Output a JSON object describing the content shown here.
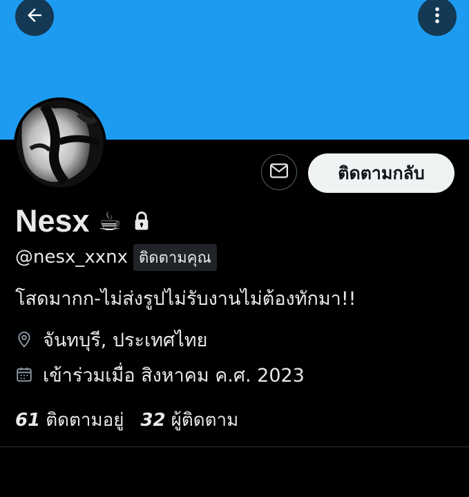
{
  "colors": {
    "banner": "#1d9bf0",
    "background": "#000000",
    "text": "#e7e9ea",
    "button_bg": "#eff3f4",
    "button_text": "#0f1419"
  },
  "header": {
    "back_icon": "arrow-left-icon",
    "more_icon": "more-vertical-icon"
  },
  "profile": {
    "name": "Nesx",
    "name_emoji": "☕",
    "protected_icon": "lock-icon",
    "handle": "@nesx_xxnx",
    "follows_you_label": "ติดตามคุณ",
    "bio": "โสดมากก-ไม่ส่งรูปไม่รับงานไม่ต้องทักมา!!",
    "location": "จันทบุรี, ประเทศไทย",
    "joined": "เข้าร่วมเมื่อ สิงหาคม ค.ศ. 2023"
  },
  "actions": {
    "message_icon": "envelope-icon",
    "follow_back_label": "ติดตามกลับ"
  },
  "stats": {
    "following_count": "61",
    "following_label": "ติดตามอยู่",
    "followers_count": "32",
    "followers_label": "ผู้ติดตาม"
  }
}
